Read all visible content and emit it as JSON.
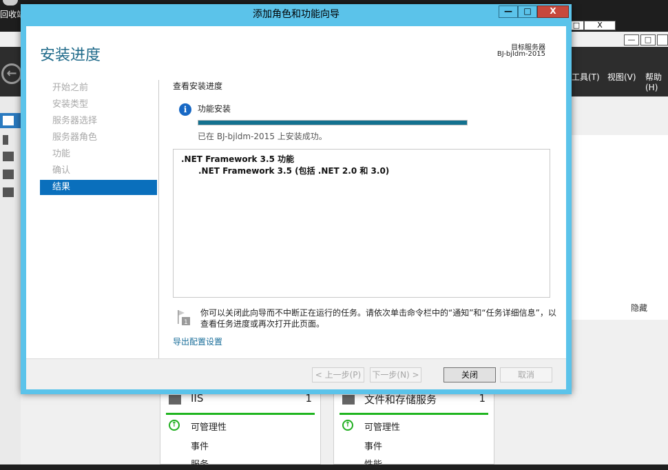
{
  "desktop": {
    "recycle_bin_label": "回收站"
  },
  "background_app": {
    "menu": [
      "工具(T)",
      "视图(V)",
      "帮助(H)"
    ],
    "side_panel_hide": "隐藏",
    "tiles": [
      {
        "title": "IIS",
        "count": "1",
        "rows": [
          "可管理性",
          "事件",
          "服务"
        ]
      },
      {
        "title": "文件和存储服务",
        "count": "1",
        "rows": [
          "可管理性",
          "事件",
          "性能"
        ]
      }
    ],
    "window_controls": {
      "min": "—",
      "max": "□",
      "close": "X"
    }
  },
  "wizard": {
    "window_title": "添加角色和功能向导",
    "controls": {
      "min": "—",
      "max": "□",
      "close": "X"
    },
    "page_title": "安装进度",
    "target_server_label": "目标服务器",
    "target_server_name": "BJ-bjldm-2015",
    "nav": [
      {
        "label": "开始之前",
        "active": false
      },
      {
        "label": "安装类型",
        "active": false
      },
      {
        "label": "服务器选择",
        "active": false
      },
      {
        "label": "服务器角色",
        "active": false
      },
      {
        "label": "功能",
        "active": false
      },
      {
        "label": "确认",
        "active": false
      },
      {
        "label": "结果",
        "active": true
      }
    ],
    "section_label": "查看安装进度",
    "task_name": "功能安装",
    "progress_percent": 100,
    "status_text": "已在 BJ-bjldm-2015 上安装成功。",
    "results": {
      "feature": ".NET Framework 3.5 功能",
      "subfeature": ".NET Framework 3.5 (包括 .NET 2.0 和 3.0)"
    },
    "note_badge": "1",
    "note_text": "你可以关闭此向导而不中断正在运行的任务。请依次单击命令栏中的“通知”和“任务详细信息”，以查看任务进度或再次打开此页面。",
    "export_link": "导出配置设置",
    "buttons": {
      "previous": "< 上一步(P)",
      "next": "下一步(N) >",
      "close": "关闭",
      "cancel": "取消"
    },
    "colors": {
      "accent": "#5bc3ea",
      "progress": "#13718f",
      "nav_active": "#0a6fbc"
    }
  }
}
